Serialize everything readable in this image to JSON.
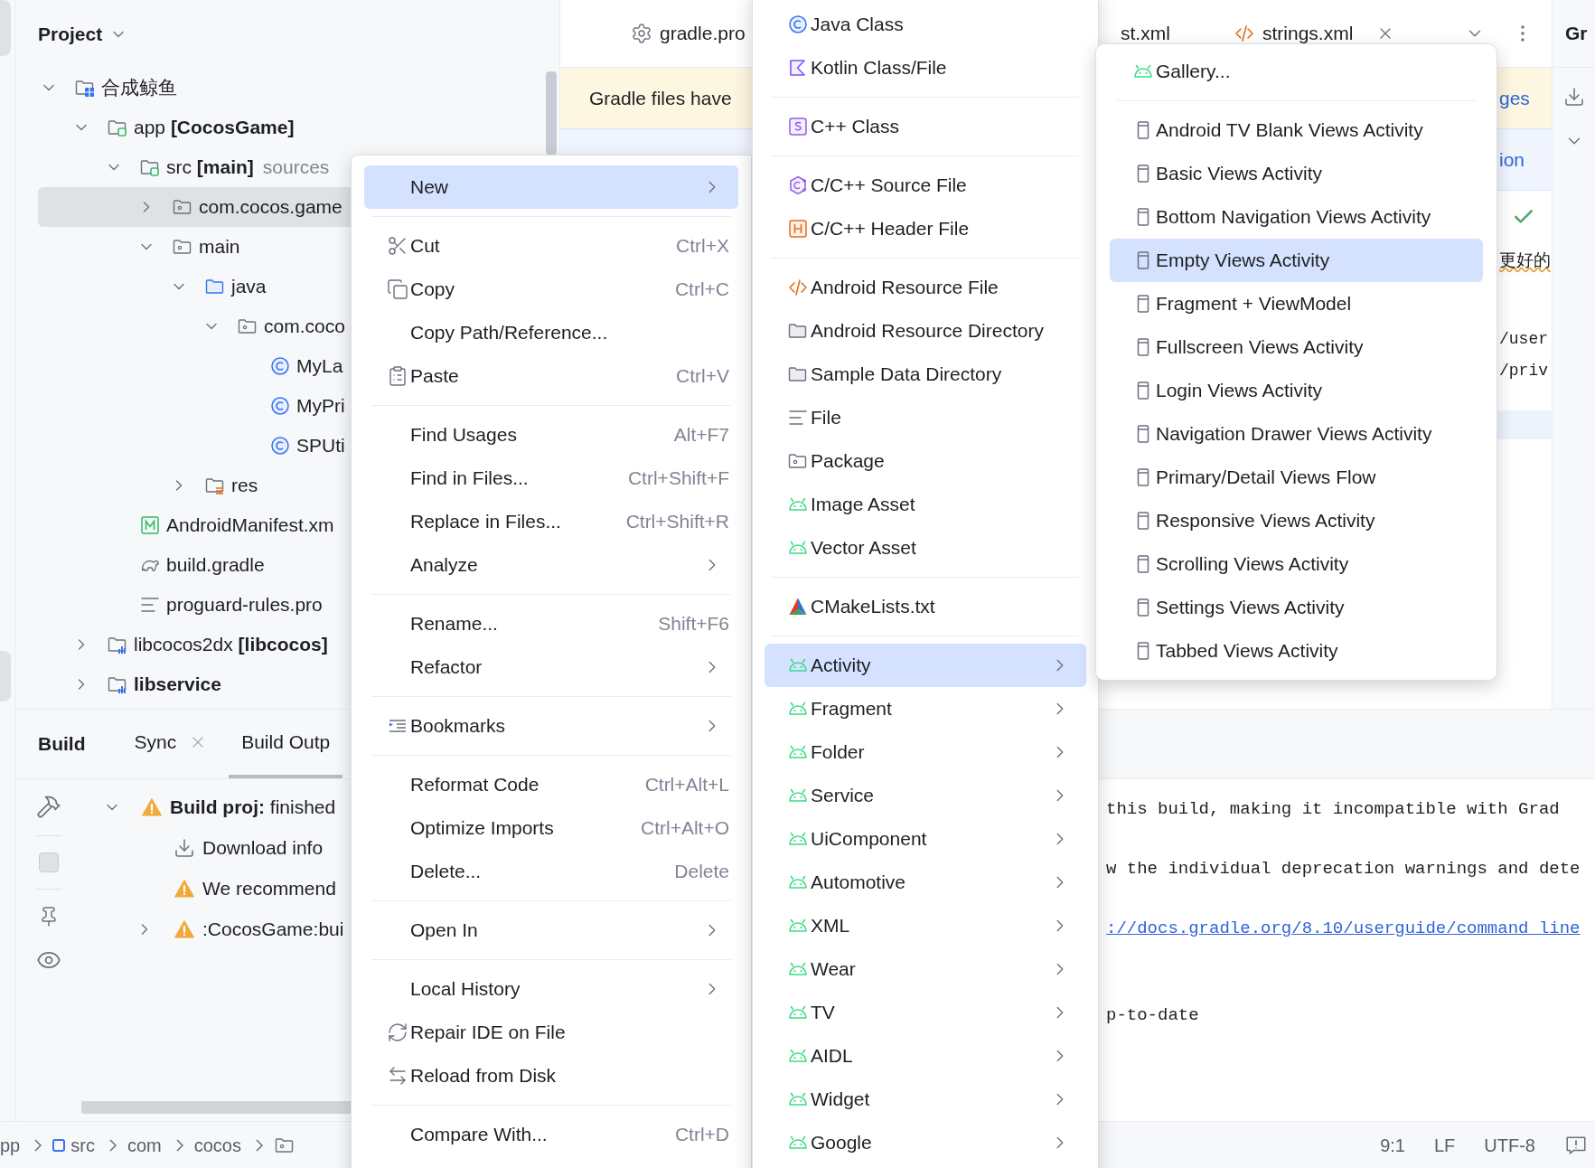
{
  "project_panel": {
    "title": "Project",
    "tree": [
      {
        "label": "合成鲸鱼",
        "kind": "project",
        "expanded": true,
        "selected": false,
        "children": [
          {
            "label": "app **[CocosGame]**",
            "kind": "module",
            "expanded": true,
            "selected": false,
            "children": [
              {
                "label": "src **[main]**",
                "hint": "sources",
                "kind": "source",
                "expanded": true,
                "selected": false,
                "children": [
                  {
                    "label": "com.cocos.game",
                    "kind": "package",
                    "expanded": false,
                    "selected": true
                  },
                  {
                    "label": "main",
                    "kind": "package",
                    "expanded": true,
                    "selected": false,
                    "children": [
                      {
                        "label": "java",
                        "kind": "java",
                        "expanded": true,
                        "selected": false,
                        "children": [
                          {
                            "label": "com.coco",
                            "kind": "package",
                            "expanded": true,
                            "selected": false,
                            "children": [
                              {
                                "label": "MyLa",
                                "kind": "class",
                                "selected": false
                              },
                              {
                                "label": "MyPri",
                                "kind": "class",
                                "selected": false
                              },
                              {
                                "label": "SPUti",
                                "kind": "class",
                                "selected": false
                              }
                            ]
                          }
                        ]
                      },
                      {
                        "label": "res",
                        "kind": "res",
                        "expanded": false,
                        "selected": false
                      }
                    ]
                  }
                ]
              },
              {
                "label": "AndroidManifest.xm",
                "kind": "manifest",
                "selected": false
              },
              {
                "label": "build.gradle",
                "kind": "gradle",
                "selected": false
              },
              {
                "label": "proguard-rules.pro",
                "kind": "text",
                "selected": false
              }
            ]
          },
          {
            "label": "libcocos2dx **[libcocos]**",
            "kind": "library",
            "expanded": false,
            "selected": false
          },
          {
            "label": "**libservice**",
            "kind": "library",
            "expanded": false,
            "selected": false
          }
        ]
      }
    ]
  },
  "editor": {
    "tabs": [
      {
        "label": "gradle.pro",
        "kind": "settings",
        "closable": false
      },
      {
        "label": "st.xml",
        "kind": "plain",
        "closable": false
      },
      {
        "label": "strings.xml",
        "kind": "xml",
        "closable": true
      }
    ],
    "banner": {
      "text": "Gradle files have",
      "link": "ges"
    },
    "info_row": "ion",
    "chinese_text": "更好的",
    "code_lines": [
      "/user",
      "/priv"
    ]
  },
  "right_strip": {
    "title": "Gr"
  },
  "build_panel": {
    "title": "Build",
    "tabs": [
      {
        "label": "Sync",
        "closable": true,
        "selected": false
      },
      {
        "label": "Build Outp",
        "closable": false,
        "selected": true
      }
    ],
    "tree": [
      {
        "label": "**Build proj:** finished",
        "kind": "warning",
        "expanded": true,
        "children": [
          {
            "label": "Download info",
            "kind": "download"
          },
          {
            "label": "We recommend",
            "kind": "warning"
          },
          {
            "label": ":CocosGame:bui",
            "kind": "warning",
            "expanded": false
          }
        ]
      }
    ]
  },
  "output": {
    "lines": [
      {
        "text": "this build, making it incompatible with Grad",
        "kind": "text"
      },
      {
        "text": "w the individual deprecation warnings and dete",
        "kind": "text"
      },
      {
        "text": "://docs.gradle.org/8.10/userguide/command_line",
        "kind": "link"
      },
      {
        "text": "p-to-date",
        "kind": "text"
      }
    ]
  },
  "breadcrumb": [
    {
      "label": "pp",
      "kind": "plain"
    },
    {
      "label": "src",
      "kind": "source"
    },
    {
      "label": "com",
      "kind": "plain"
    },
    {
      "label": "cocos",
      "kind": "plain"
    }
  ],
  "status": [
    "9:1",
    "LF",
    "UTF-8"
  ],
  "context_menu": {
    "groups": [
      [
        {
          "label": "New",
          "submenu": true,
          "selected": true
        }
      ],
      [
        {
          "label": "Cut",
          "shortcut": "Ctrl+X",
          "submenu": false,
          "selected": false
        },
        {
          "label": "Copy",
          "shortcut": "Ctrl+C",
          "submenu": false,
          "selected": false
        },
        {
          "label": "Copy Path/Reference...",
          "submenu": false,
          "selected": false
        },
        {
          "label": "Paste",
          "shortcut": "Ctrl+V",
          "submenu": false,
          "selected": false
        }
      ],
      [
        {
          "label": "Find Usages",
          "shortcut": "Alt+F7",
          "submenu": false,
          "selected": false
        },
        {
          "label": "Find in Files...",
          "shortcut": "Ctrl+Shift+F",
          "submenu": false,
          "selected": false
        },
        {
          "label": "Replace in Files...",
          "shortcut": "Ctrl+Shift+R",
          "submenu": false,
          "selected": false
        },
        {
          "label": "Analyze",
          "submenu": true,
          "selected": false
        }
      ],
      [
        {
          "label": "Rename...",
          "shortcut": "Shift+F6",
          "submenu": false,
          "selected": false
        },
        {
          "label": "Refactor",
          "submenu": true,
          "selected": false
        }
      ],
      [
        {
          "label": "Bookmarks",
          "submenu": true,
          "selected": false
        }
      ],
      [
        {
          "label": "Reformat Code",
          "shortcut": "Ctrl+Alt+L",
          "submenu": false,
          "selected": false
        },
        {
          "label": "Optimize Imports",
          "shortcut": "Ctrl+Alt+O",
          "submenu": false,
          "selected": false
        },
        {
          "label": "Delete...",
          "shortcut": "Delete",
          "submenu": false,
          "selected": false
        }
      ],
      [
        {
          "label": "Open In",
          "submenu": true,
          "selected": false
        }
      ],
      [
        {
          "label": "Local History",
          "submenu": true,
          "selected": false
        },
        {
          "label": "Repair IDE on File",
          "submenu": false,
          "selected": false
        },
        {
          "label": "Reload from Disk",
          "submenu": false,
          "selected": false
        }
      ],
      [
        {
          "label": "Compare With...",
          "shortcut": "Ctrl+D",
          "submenu": false,
          "selected": false
        }
      ]
    ]
  },
  "new_menu": {
    "groups": [
      [
        {
          "label": "Java Class",
          "submenu": false,
          "selected": false
        },
        {
          "label": "Kotlin Class/File",
          "submenu": false,
          "selected": false
        }
      ],
      [
        {
          "label": "C++ Class",
          "submenu": false,
          "selected": false
        }
      ],
      [
        {
          "label": "C/C++ Source File",
          "submenu": false,
          "selected": false
        },
        {
          "label": "C/C++ Header File",
          "submenu": false,
          "selected": false
        }
      ],
      [
        {
          "label": "Android Resource File",
          "submenu": false,
          "selected": false
        },
        {
          "label": "Android Resource Directory",
          "submenu": false,
          "selected": false
        },
        {
          "label": "Sample Data Directory",
          "submenu": false,
          "selected": false
        },
        {
          "label": "File",
          "submenu": false,
          "selected": false
        },
        {
          "label": "Package",
          "submenu": false,
          "selected": false
        },
        {
          "label": "Image Asset",
          "submenu": false,
          "selected": false
        },
        {
          "label": "Vector Asset",
          "submenu": false,
          "selected": false
        }
      ],
      [
        {
          "label": "CMakeLists.txt",
          "submenu": false,
          "selected": false
        }
      ],
      [
        {
          "label": "Activity",
          "submenu": true,
          "selected": true
        },
        {
          "label": "Fragment",
          "submenu": true,
          "selected": false
        },
        {
          "label": "Folder",
          "submenu": true,
          "selected": false
        },
        {
          "label": "Service",
          "submenu": true,
          "selected": false
        },
        {
          "label": "UiComponent",
          "submenu": true,
          "selected": false
        },
        {
          "label": "Automotive",
          "submenu": true,
          "selected": false
        },
        {
          "label": "XML",
          "submenu": true,
          "selected": false
        },
        {
          "label": "Wear",
          "submenu": true,
          "selected": false
        },
        {
          "label": "TV",
          "submenu": true,
          "selected": false
        },
        {
          "label": "AIDL",
          "submenu": true,
          "selected": false
        },
        {
          "label": "Widget",
          "submenu": true,
          "selected": false
        },
        {
          "label": "Google",
          "submenu": true,
          "selected": false
        }
      ]
    ]
  },
  "activity_menu": {
    "groups": [
      [
        {
          "label": "Gallery...",
          "selected": false
        }
      ],
      [
        {
          "label": "Android TV Blank Views Activity",
          "selected": false
        },
        {
          "label": "Basic Views Activity",
          "selected": false
        },
        {
          "label": "Bottom Navigation Views Activity",
          "selected": false
        },
        {
          "label": "Empty Views Activity",
          "selected": true
        },
        {
          "label": "Fragment + ViewModel",
          "selected": false
        },
        {
          "label": "Fullscreen Views Activity",
          "selected": false
        },
        {
          "label": "Login Views Activity",
          "selected": false
        },
        {
          "label": "Navigation Drawer Views Activity",
          "selected": false
        },
        {
          "label": "Primary/Detail Views Flow",
          "selected": false
        },
        {
          "label": "Responsive Views Activity",
          "selected": false
        },
        {
          "label": "Scrolling Views Activity",
          "selected": false
        },
        {
          "label": "Settings Views Activity",
          "selected": false
        },
        {
          "label": "Tabbed Views Activity",
          "selected": false
        }
      ]
    ]
  }
}
